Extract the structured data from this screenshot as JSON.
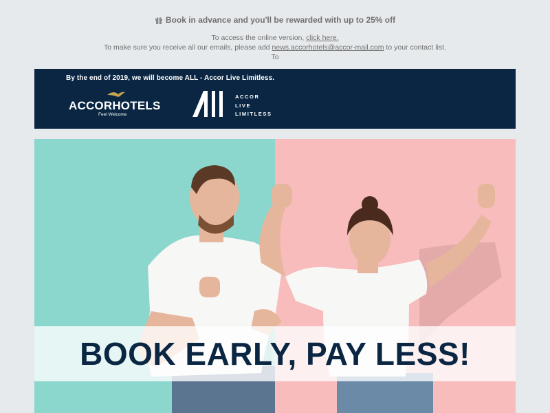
{
  "preheader": {
    "promo_text": "Book in advance and you'll be rewarded with up to 25% off",
    "gift_icon": "gift-icon",
    "online_version_prefix": "To access the online version, ",
    "online_version_link": "click here.",
    "contact_prefix": "To make sure you receive all our emails, please add ",
    "contact_email": "news.accorhotels@accor-mail.com",
    "contact_suffix": " to your contact list.",
    "trailing": "To"
  },
  "banner": {
    "announcement": "By the end of 2019, we will become ALL - Accor Live Limitless.",
    "accor_brand": "ACCORHOTELS",
    "accor_tagline": "Feel Welcome",
    "all_lines": [
      "ACCOR",
      "LIVE",
      "LIMITLESS"
    ],
    "background_color": "#0a2643"
  },
  "hero": {
    "headline": "BOOK EARLY, PAY LESS!",
    "left_color": "#8bd6cd",
    "right_color": "#f7bcbb",
    "headline_color": "#0a2643"
  }
}
